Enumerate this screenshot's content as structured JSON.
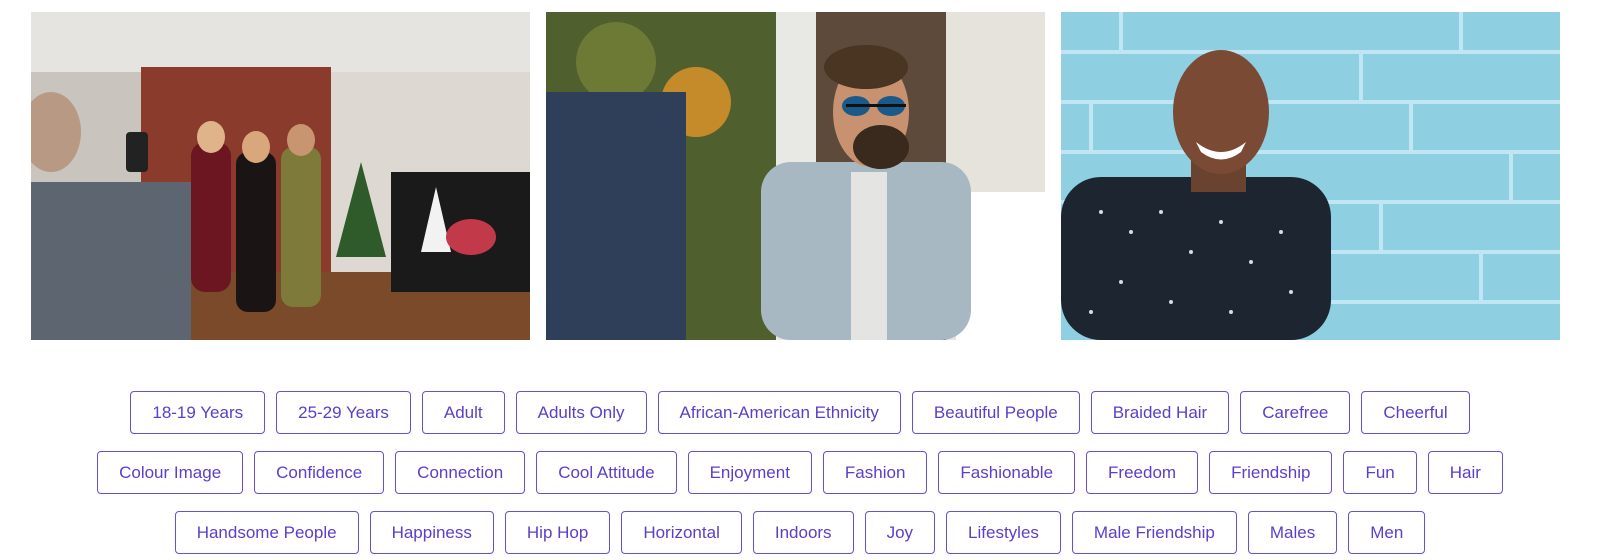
{
  "gallery": {
    "images": [
      {
        "name": "party-photo-image"
      },
      {
        "name": "man-sunglasses-image"
      },
      {
        "name": "man-brick-wall-image"
      }
    ]
  },
  "tags": {
    "rows": [
      [
        "18-19 Years",
        "25-29 Years",
        "Adult",
        "Adults Only",
        "African-American Ethnicity",
        "Beautiful People",
        "Braided Hair",
        "Carefree",
        "Cheerful"
      ],
      [
        "Colour Image",
        "Confidence",
        "Connection",
        "Cool Attitude",
        "Enjoyment",
        "Fashion",
        "Fashionable",
        "Freedom",
        "Friendship",
        "Fun",
        "Hair"
      ],
      [
        "Handsome People",
        "Happiness",
        "Hip Hop",
        "Horizontal",
        "Indoors",
        "Joy",
        "Lifestyles",
        "Male Friendship",
        "Males",
        "Men"
      ]
    ]
  },
  "colors": {
    "tag_border": "#6a4fd4",
    "tag_text": "#5a3fc8"
  }
}
